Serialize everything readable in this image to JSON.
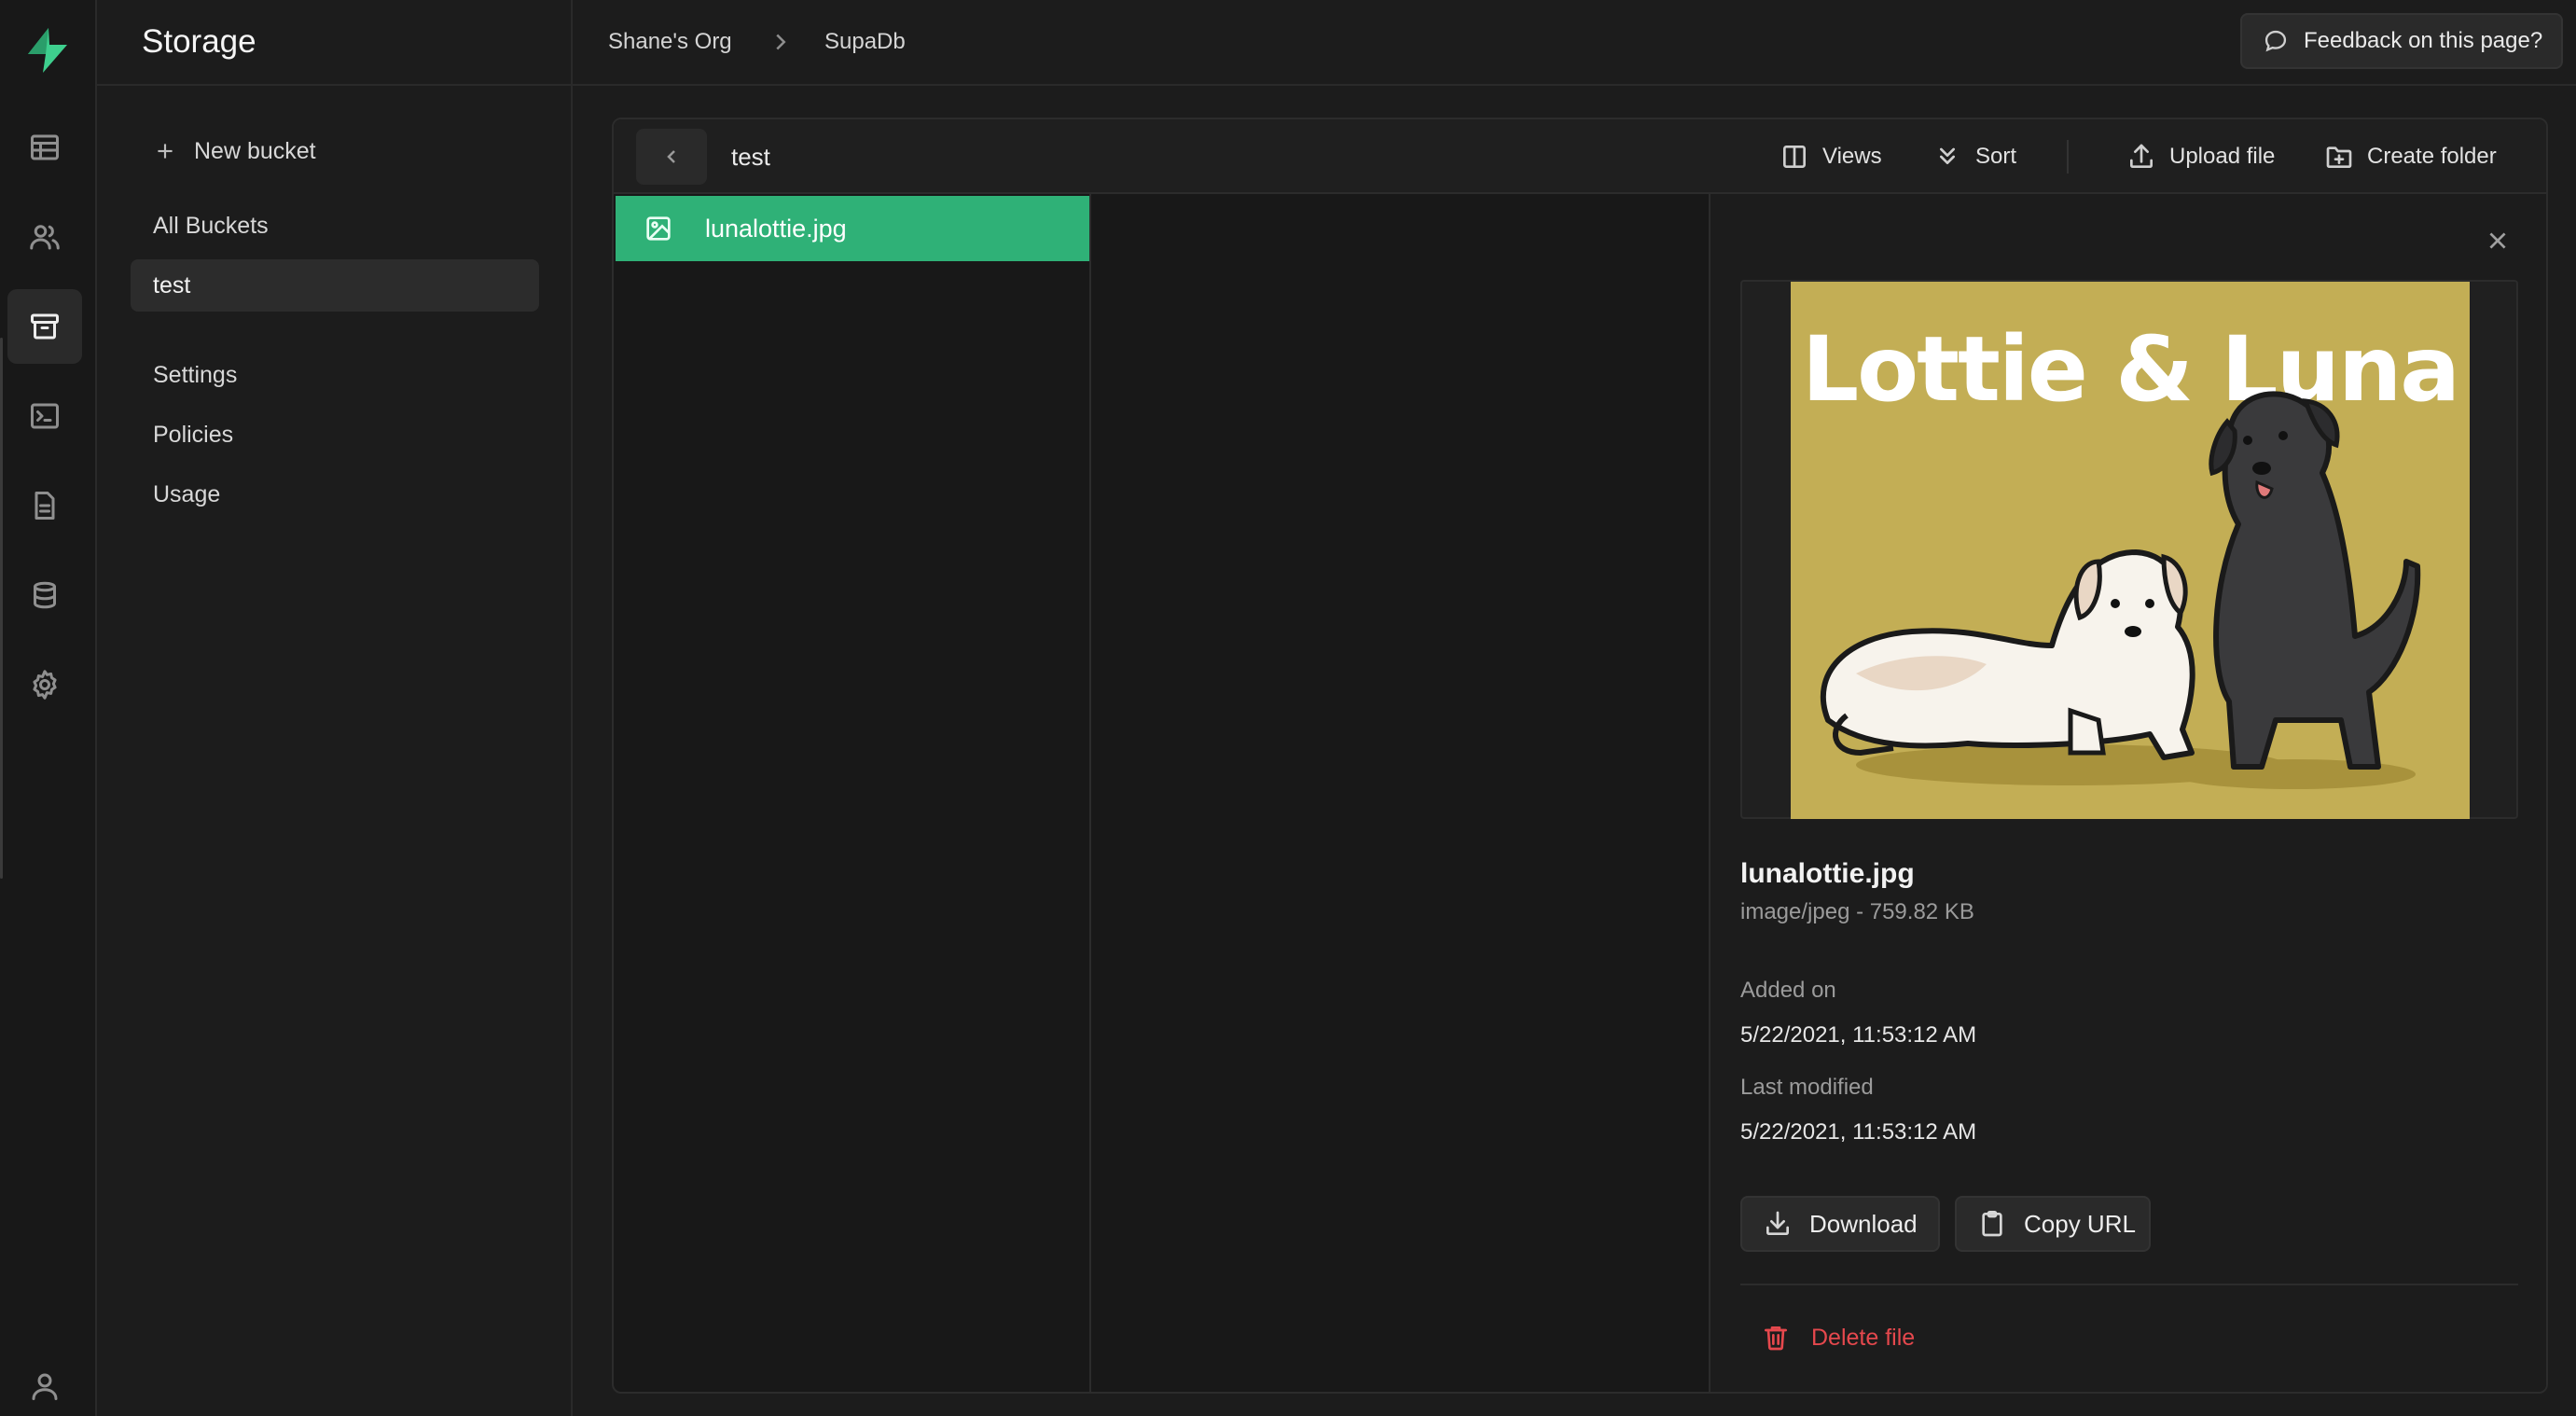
{
  "app": {
    "section_title": "Storage",
    "accent_color": "#2fb177",
    "rail_icons": [
      "table-icon",
      "users-icon",
      "archive-icon",
      "terminal-icon",
      "document-icon",
      "database-icon",
      "gear-icon",
      "user-icon"
    ]
  },
  "breadcrumb": {
    "org": "Shane's Org",
    "project": "SupaDb"
  },
  "header": {
    "feedback_label": "Feedback on this page?"
  },
  "sidebar": {
    "new_bucket_label": "New bucket",
    "all_buckets_label": "All Buckets",
    "buckets": [
      "test"
    ],
    "settings_label": "Settings",
    "policies_label": "Policies",
    "usage_label": "Usage"
  },
  "explorer": {
    "current_path": "test",
    "toolbar": {
      "views_label": "Views",
      "sort_label": "Sort",
      "upload_label": "Upload file",
      "create_folder_label": "Create folder"
    },
    "files": [
      {
        "name": "lunalottie.jpg",
        "selected": true
      }
    ]
  },
  "preview": {
    "image_caption": "Lottie & Luna",
    "file_name": "lunalottie.jpg",
    "file_meta": "image/jpeg - 759.82 KB",
    "added_on_label": "Added on",
    "added_on_value": "5/22/2021, 11:53:12 AM",
    "last_modified_label": "Last modified",
    "last_modified_value": "5/22/2021, 11:53:12 AM",
    "download_label": "Download",
    "copy_url_label": "Copy URL",
    "delete_label": "Delete file",
    "delete_color": "#e5484d"
  }
}
